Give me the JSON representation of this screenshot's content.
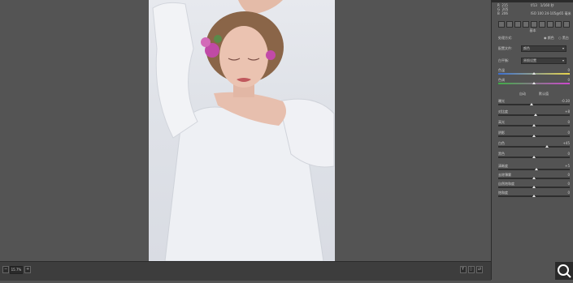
{
  "panel": {
    "info": {
      "r_label": "R",
      "r_value": "215",
      "g_label": "G",
      "g_value": "205",
      "b_label": "B",
      "b_value": "206",
      "aperture": "f/13",
      "shutter": "1/160 秒",
      "iso": "ISO 100",
      "lens": "24-105@65 毫米"
    },
    "section_basic": "基本",
    "treatment_label": "处理方式:",
    "treatment_color": "颜色",
    "treatment_bw": "黑白",
    "profile_label": "配置文件:",
    "profile_value": "颜色",
    "wb_label": "白平衡:",
    "wb_value": "原照设置",
    "sliders_wb": [
      {
        "label": "色温",
        "value": "0",
        "position": 0.5,
        "gradient": "linear-gradient(90deg,#3b6fd2,#e9d44a)"
      },
      {
        "label": "色调",
        "value": "0",
        "position": 0.5,
        "gradient": "linear-gradient(90deg,#3fae45,#cf46cf)"
      }
    ],
    "auto_label": "自动",
    "default_label": "默认值",
    "sliders_tone": [
      {
        "label": "曝光",
        "value": "-0.30",
        "position": 0.47
      },
      {
        "label": "对比度",
        "value": "+8",
        "position": 0.52
      },
      {
        "label": "高光",
        "value": "0",
        "position": 0.5
      },
      {
        "label": "阴影",
        "value": "0",
        "position": 0.5
      },
      {
        "label": "白色",
        "value": "+45",
        "position": 0.68
      },
      {
        "label": "黑色",
        "value": "0",
        "position": 0.5
      }
    ],
    "sliders_presence": [
      {
        "label": "清晰度",
        "value": "+5",
        "position": 0.53
      },
      {
        "label": "去除薄雾",
        "value": "0",
        "position": 0.5
      },
      {
        "label": "自然饱和度",
        "value": "0",
        "position": 0.5
      },
      {
        "label": "饱和度",
        "value": "0",
        "position": 0.5
      }
    ]
  },
  "bottom_bar": {
    "zoom_value": "15.7%"
  },
  "icons": {
    "search": "search-icon"
  }
}
